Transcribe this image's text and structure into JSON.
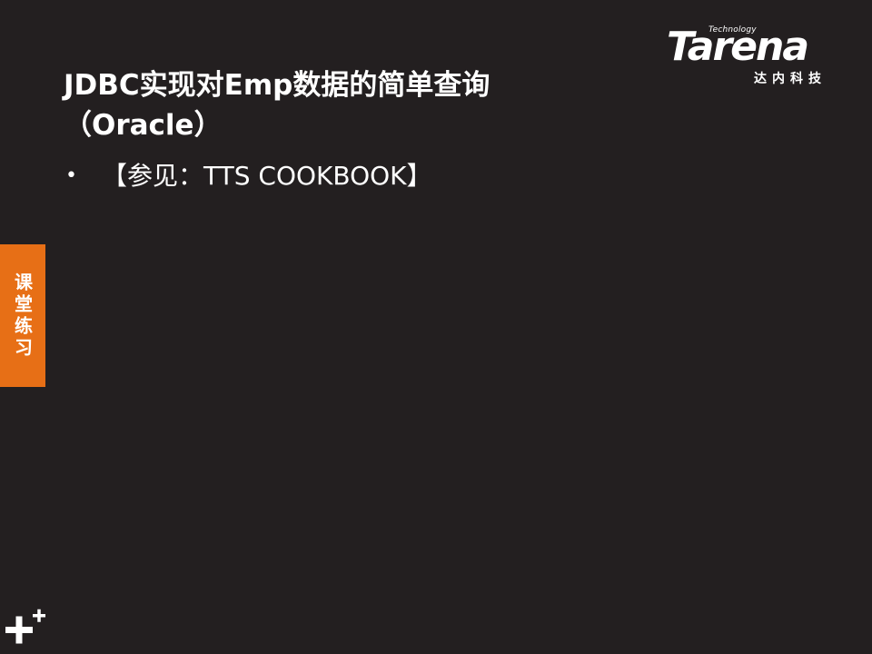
{
  "logo": {
    "word": "Tarena",
    "tagline": "Technology",
    "chinese": "达内科技"
  },
  "title": {
    "line1": "JDBC实现对Emp数据的简单查询",
    "line2": "（Oracle）"
  },
  "bullets": [
    {
      "text": "【参见：TTS COOKBOOK】"
    }
  ],
  "side_tab": {
    "label": "课堂练习"
  },
  "colors": {
    "background": "#231f20",
    "accent": "#e76f16",
    "text": "#ffffff"
  },
  "icons": {
    "corner": "plus-icon"
  }
}
